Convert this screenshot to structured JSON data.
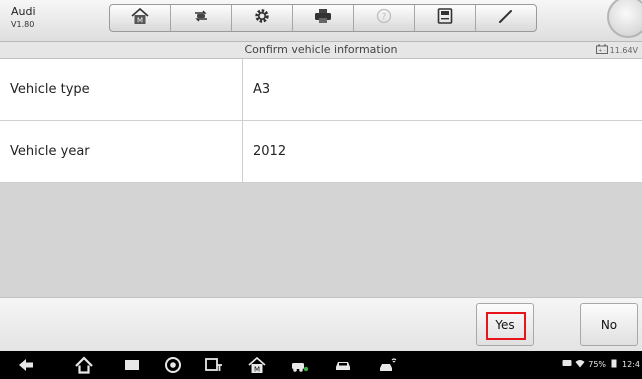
{
  "app": {
    "name": "Audi",
    "version": "V1.80"
  },
  "toolbar": {
    "tools": [
      {
        "icon": "home-icon"
      },
      {
        "icon": "vehicle-swap-icon"
      },
      {
        "icon": "settings-gear-icon"
      },
      {
        "icon": "printer-icon"
      },
      {
        "icon": "help-icon"
      },
      {
        "icon": "save-icon"
      },
      {
        "icon": "edit-pen-icon"
      }
    ]
  },
  "header": {
    "title": "Confirm vehicle information",
    "battery_voltage": "11.64V"
  },
  "info_rows": [
    {
      "label": "Vehicle type",
      "value": "A3"
    },
    {
      "label": "Vehicle year",
      "value": "2012"
    }
  ],
  "actions": {
    "yes_label": "Yes",
    "no_label": "No"
  },
  "navbar": {
    "icons": [
      "back-icon",
      "home-icon",
      "recent-apps-icon",
      "chrome-icon",
      "screen-tool-icon",
      "maxifix-home-icon",
      "vehicle-service-icon",
      "car-icon",
      "remote-car-icon"
    ]
  },
  "status": {
    "battery_percent": "75%",
    "time": "12:4"
  },
  "colors": {
    "highlight": "#e8141c",
    "toolbar_bg": "#e9e9e9",
    "nav_bg": "#000000"
  }
}
